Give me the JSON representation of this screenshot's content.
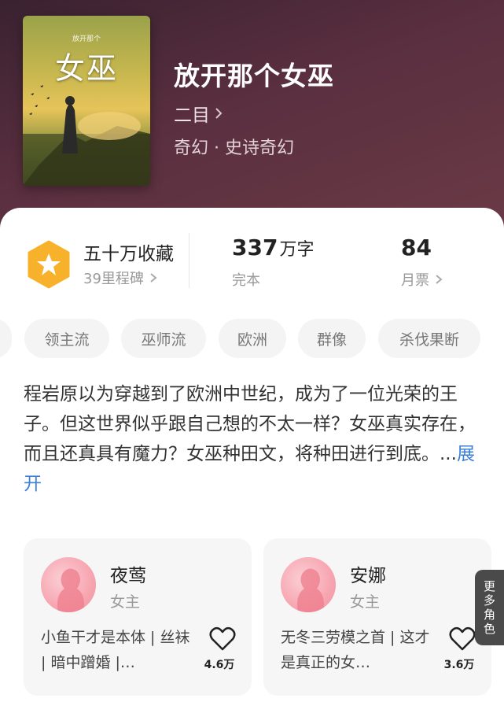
{
  "book": {
    "cover_title": "女巫",
    "cover_sub": "放开那个",
    "title": "放开那个女巫",
    "author": "二目",
    "genre": "奇幻 · 史诗奇幻"
  },
  "stats": {
    "collection": "五十万收藏",
    "milestones": "39里程碑",
    "word_count": "337",
    "word_unit": "万字",
    "status": "完本",
    "monthly_tickets": "84",
    "monthly_label": "月票"
  },
  "tags": [
    "领主流",
    "巫师流",
    "欧洲",
    "群像",
    "杀伐果断"
  ],
  "description": {
    "text": "程岩原以为穿越到了欧洲中世纪，成为了一位光荣的王子。但这世界似乎跟自己想的不太一样？女巫真实存在，而且还真具有魔力？女巫种田文，将种田进行到底。...",
    "expand": "展开"
  },
  "characters": [
    {
      "name": "夜莺",
      "role": "女主",
      "desc": "小鱼干才是本体 | 丝袜 | 暗中蹭婚 |…",
      "likes": "4.6万"
    },
    {
      "name": "安娜",
      "role": "女主",
      "desc": "无冬三劳模之首 | 这才是真正的女…",
      "likes": "3.6万"
    }
  ],
  "more_roles": [
    "更",
    "多",
    "角",
    "色"
  ],
  "colors": {
    "accent_blue": "#3b7fd9",
    "badge_orange": "#f7b12a",
    "hero_bg": "#5a2f3f"
  }
}
